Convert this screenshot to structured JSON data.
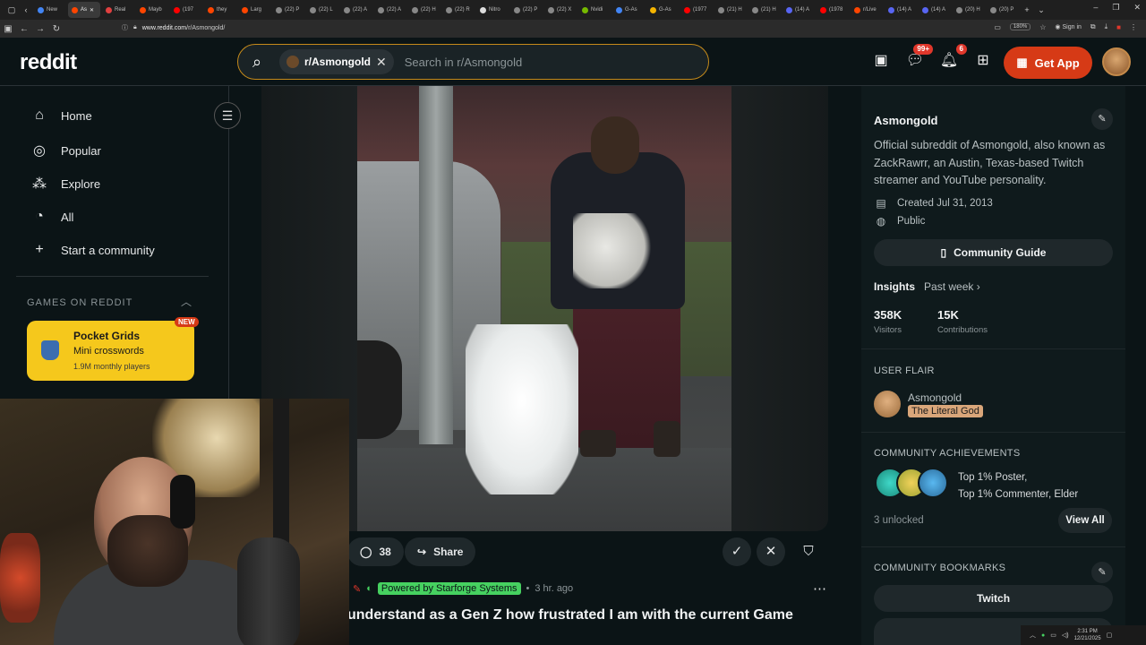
{
  "browser": {
    "tabs": [
      {
        "label": "New",
        "color": "#4285f4"
      },
      {
        "label": "As",
        "color": "#ff4500",
        "active": true
      },
      {
        "label": "Real",
        "color": "#e04040"
      },
      {
        "label": "Mayb",
        "color": "#ff4500"
      },
      {
        "label": "(197",
        "color": "#ff0000"
      },
      {
        "label": "they",
        "color": "#ff4500"
      },
      {
        "label": "Larg",
        "color": "#ff4500"
      },
      {
        "label": "(22) P",
        "color": "#888888"
      },
      {
        "label": "(22) L",
        "color": "#888888"
      },
      {
        "label": "(22) A",
        "color": "#888888"
      },
      {
        "label": "(22) A",
        "color": "#888888"
      },
      {
        "label": "(22) H",
        "color": "#888888"
      },
      {
        "label": "(22) R",
        "color": "#888888"
      },
      {
        "label": "Nitro",
        "color": "#dddddd"
      },
      {
        "label": "(22) P",
        "color": "#888888"
      },
      {
        "label": "(22) X",
        "color": "#888888"
      },
      {
        "label": "Nvidi",
        "color": "#76b900"
      },
      {
        "label": "G-As",
        "color": "#4285f4"
      },
      {
        "label": "G-As",
        "color": "#f4b400"
      },
      {
        "label": "(1977",
        "color": "#ff0000"
      },
      {
        "label": "(21) H",
        "color": "#888888"
      },
      {
        "label": "(21) H",
        "color": "#888888"
      },
      {
        "label": "(14) A",
        "color": "#5865f2"
      },
      {
        "label": "(1978",
        "color": "#ff0000"
      },
      {
        "label": "r/Live",
        "color": "#ff4500"
      },
      {
        "label": "(14) A",
        "color": "#5865f2"
      },
      {
        "label": "(14) A",
        "color": "#5865f2"
      },
      {
        "label": "(20) H",
        "color": "#888888"
      },
      {
        "label": "(20) P",
        "color": "#888888"
      }
    ],
    "url_host": "www.reddit.com",
    "url_path": "/r/Asmongold/",
    "zoom": "180%",
    "signin": "Sign in"
  },
  "header": {
    "logo": "reddit",
    "search_chip": "r/Asmongold",
    "search_placeholder": "Search in r/Asmongold",
    "chat_badge": "99+",
    "notif_badge": "6",
    "get_app": "Get App"
  },
  "sidebar": {
    "items": [
      {
        "label": "Home",
        "icon": "home-icon",
        "glyph": "⌂"
      },
      {
        "label": "Popular",
        "icon": "popular-icon",
        "glyph": "◎"
      },
      {
        "label": "Explore",
        "icon": "explore-icon",
        "glyph": "⁂"
      },
      {
        "label": "All",
        "icon": "all-icon",
        "glyph": "◔"
      },
      {
        "label": "Start a community",
        "icon": "plus-icon",
        "glyph": "+"
      }
    ],
    "games_heading": "GAMES ON REDDIT",
    "game": {
      "title": "Pocket Grids",
      "subtitle": "Mini crosswords",
      "players": "1.9M monthly players",
      "tag": "NEW"
    }
  },
  "post": {
    "comments": "38",
    "share": "Share",
    "flair": "Powered by Starforge Systems",
    "time": "3 hr. ago",
    "title": "understand as a Gen Z how frustrated I am with the current Game"
  },
  "community": {
    "name": "Asmongold",
    "description": "Official subreddit of Asmongold, also known as ZackRawrr, an Austin, Texas-based Twitch streamer and YouTube personality.",
    "created": "Created Jul 31, 2013",
    "visibility": "Public",
    "guide_label": "Community Guide",
    "insights_label": "Insights",
    "insights_period": "Past week",
    "visitors_value": "358K",
    "visitors_label": "Visitors",
    "contrib_value": "15K",
    "contrib_label": "Contributions",
    "user_flair_heading": "USER FLAIR",
    "flair_user": "Asmongold",
    "flair_text": "The Literal God",
    "achievements_heading": "COMMUNITY ACHIEVEMENTS",
    "achievement_line1": "Top 1% Poster,",
    "achievement_line2": "Top 1% Commenter, Elder",
    "unlocked": "3 unlocked",
    "view_all": "View All",
    "bookmarks_heading": "COMMUNITY BOOKMARKS",
    "bookmark1": "Twitch"
  },
  "taskbar": {
    "time": "2:31 PM",
    "date": "12/21/2025"
  }
}
